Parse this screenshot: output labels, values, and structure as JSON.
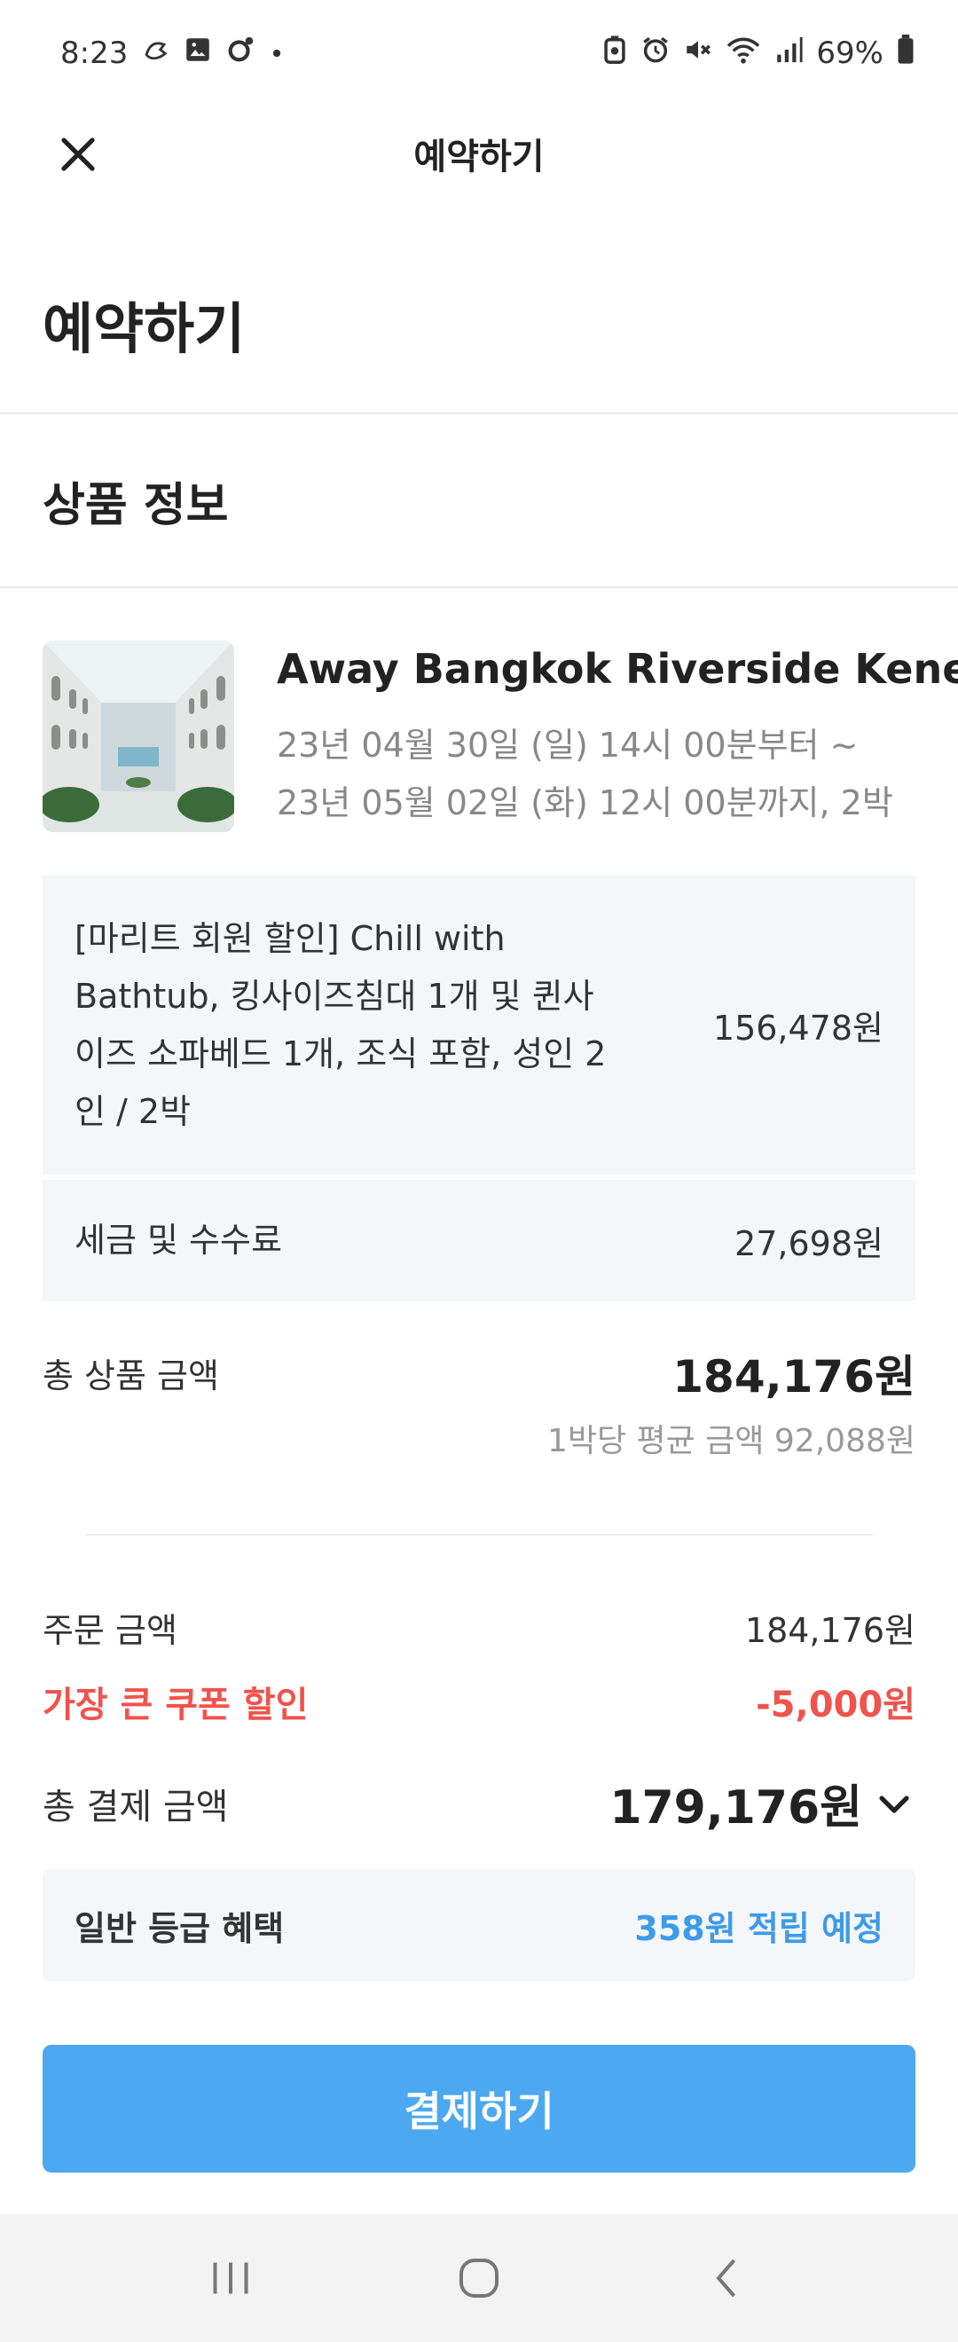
{
  "status_bar": {
    "time": "8:23",
    "battery": "69%",
    "left_icons": [
      "activity-icon",
      "gallery-icon",
      "app-notification-icon",
      "dot-icon"
    ],
    "right_icons": [
      "battery-saver-icon",
      "alarm-icon",
      "mute-icon",
      "wifi-icon",
      "signal-icon",
      "battery-icon"
    ]
  },
  "app_bar": {
    "title": "예약하기"
  },
  "page": {
    "title": "예약하기"
  },
  "product_section": {
    "title": "상품 정보",
    "name": "Away Bangkok Riverside Kene",
    "date_from": "23년 04월 30일 (일) 14시 00분부터 ~",
    "date_to": "23년 05월 02일 (화) 12시 00분까지, 2박"
  },
  "options": [
    {
      "desc": "[마리트 회원 할인] Chill with Bathtub, 킹사이즈침대 1개 및 퀸사이즈 소파베드 1개, 조식 포함, 성인 2인 / 2박",
      "price": "156,478원"
    },
    {
      "desc": "세금 및 수수료",
      "price": "27,698원"
    }
  ],
  "summary": {
    "total_label": "총 상품 금액",
    "total_value": "184,176원",
    "avg": "1박당 평균 금액 92,088원",
    "order_label": "주문 금액",
    "order_value": "184,176원",
    "coupon_label": "가장 큰 쿠폰 할인",
    "coupon_value": "-5,000원",
    "pay_label": "총 결제 금액",
    "pay_value": "179,176원"
  },
  "benefit": {
    "label": "일반 등급 혜택",
    "value": "358원 적립 예정"
  },
  "cta": {
    "label": "결제하기"
  },
  "colors": {
    "accent": "#4ca8f0",
    "discount": "#f0534c",
    "benefit": "#3d9be9",
    "panel": "#f5f6f8"
  }
}
